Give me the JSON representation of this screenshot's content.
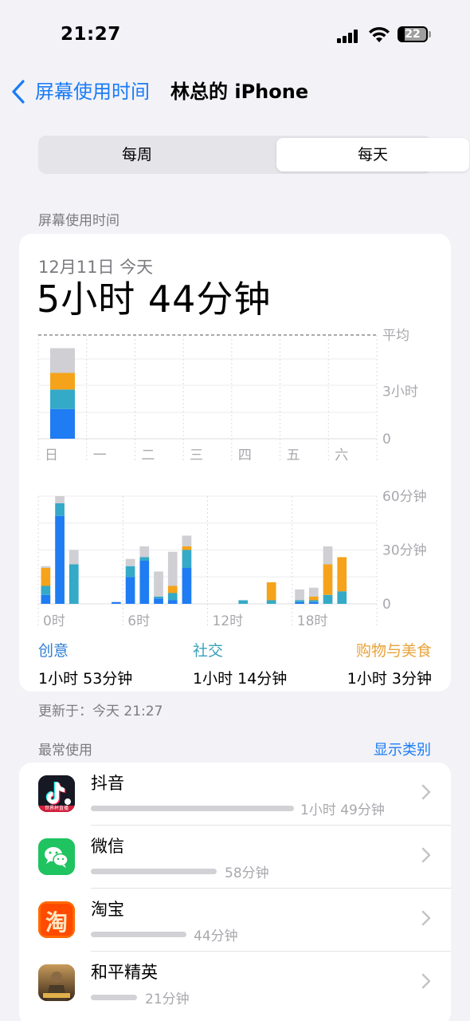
{
  "status_bar": {
    "time": "21:27",
    "battery": "22"
  },
  "nav": {
    "back_label": "屏幕使用时间",
    "title": "林总的 iPhone"
  },
  "segmented": {
    "weekly": "每周",
    "daily": "每天",
    "selected": "daily"
  },
  "screen_time": {
    "section_label": "屏幕使用时间",
    "date": "12月11日 今天",
    "total": "5小时 44分钟"
  },
  "chart_data": [
    {
      "type": "bar",
      "title": "",
      "categories": [
        "日",
        "一",
        "二",
        "三",
        "四",
        "五",
        "六"
      ],
      "y_ticks": [
        "平均",
        "3小时",
        "0"
      ],
      "ylim_minutes": [
        0,
        394
      ],
      "average_minutes": 394,
      "series": [
        {
          "name": "创意",
          "color": "#1f7cf2",
          "values": [
            113,
            0,
            0,
            0,
            0,
            0,
            0
          ]
        },
        {
          "name": "社交",
          "color": "#34aac8",
          "values": [
            74,
            0,
            0,
            0,
            0,
            0,
            0
          ]
        },
        {
          "name": "购物与美食",
          "color": "#f5a31a",
          "values": [
            63,
            0,
            0,
            0,
            0,
            0,
            0
          ]
        },
        {
          "name": "other",
          "color": "#cfcfd4",
          "values": [
            94,
            0,
            0,
            0,
            0,
            0,
            0
          ]
        }
      ]
    },
    {
      "type": "bar",
      "title": "",
      "x_tick_labels": [
        "0时",
        "6时",
        "12时",
        "18时"
      ],
      "y_ticks": [
        "60分钟",
        "30分钟",
        "0"
      ],
      "ylim_minutes": [
        0,
        60
      ],
      "hours": [
        0,
        1,
        2,
        3,
        4,
        5,
        6,
        7,
        8,
        9,
        10,
        11,
        12,
        13,
        14,
        15,
        16,
        17,
        18,
        19,
        20,
        21,
        22,
        23
      ],
      "series": [
        {
          "name": "创意",
          "color": "#1f7cf2",
          "values": [
            5,
            49,
            0,
            0,
            0,
            1,
            15,
            24,
            3,
            2,
            20,
            0,
            0,
            0,
            0,
            0,
            0,
            0,
            1,
            1,
            0,
            0,
            0,
            0
          ]
        },
        {
          "name": "社交",
          "color": "#34aac8",
          "values": [
            5,
            7,
            22,
            0,
            0,
            0,
            6,
            2,
            1,
            4,
            10,
            0,
            0,
            0,
            2,
            0,
            2,
            0,
            1,
            1,
            5,
            7,
            0,
            0
          ]
        },
        {
          "name": "购物与美食",
          "color": "#f5a31a",
          "values": [
            10,
            0,
            0,
            0,
            0,
            0,
            0,
            0,
            0,
            4,
            2,
            0,
            0,
            0,
            0,
            0,
            10,
            0,
            0,
            2,
            17,
            19,
            0,
            0
          ]
        },
        {
          "name": "other",
          "color": "#cfcfd4",
          "values": [
            1,
            4,
            8,
            0,
            0,
            0,
            4,
            6,
            14,
            19,
            6,
            0,
            0,
            0,
            0,
            0,
            0,
            0,
            6,
            5,
            10,
            0,
            0,
            0
          ]
        }
      ]
    }
  ],
  "categories_summary": [
    {
      "name": "创意",
      "duration": "1小时 53分钟",
      "color": "#2d7dd2"
    },
    {
      "name": "社交",
      "duration": "1小时 14分钟",
      "color": "#3aa0b8"
    },
    {
      "name": "购物与美食",
      "duration": "1小时 3分钟",
      "color": "#e8a33a"
    }
  ],
  "updated": "更新于：今天 21:27",
  "most_used": {
    "label": "最常使用",
    "show_categories": "显示类别",
    "apps": [
      {
        "name": "抖音",
        "duration": "1小时 49分钟",
        "minutes": 109,
        "icon": "douyin-icon",
        "icon_caption": "世界杯直播"
      },
      {
        "name": "微信",
        "duration": "58分钟",
        "minutes": 58,
        "icon": "wechat-icon"
      },
      {
        "name": "淘宝",
        "duration": "44分钟",
        "minutes": 44,
        "icon": "taobao-icon",
        "icon_caption": "淘"
      },
      {
        "name": "和平精英",
        "duration": "21分钟",
        "minutes": 21,
        "icon": "peace-elite-icon"
      }
    ]
  }
}
